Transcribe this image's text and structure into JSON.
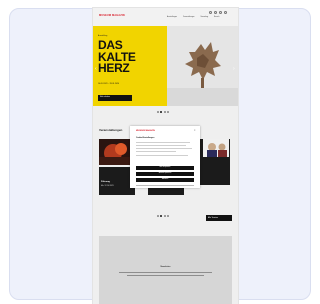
{
  "header": {
    "logo_text": "MUSEUM MAGAZIN",
    "nav": [
      "Ausstellungen",
      "Veranstaltungen",
      "Sammlung",
      "Besuch"
    ]
  },
  "hero": {
    "kicker": "Ausstellung",
    "title": "DAS KALTE HERZ",
    "dates": "14.09.2023 – 28.01.2024",
    "button_label": "Mehr erfahren",
    "accent_color": "#f1d400",
    "slider_prev": "‹",
    "slider_next": "›"
  },
  "section": {
    "title": "Veranstaltungen",
    "events": [
      {
        "title": "Führung",
        "date": "Mo. 12.10.2023"
      },
      {
        "title": "Vortrag",
        "date": "Di. 13.10.2023"
      }
    ],
    "more_label": "Alle Termine"
  },
  "cookie_modal": {
    "logo_text": "MUSEUM MAGAZIN",
    "heading": "Cookie-Einstellungen",
    "close_icon": "×",
    "buttons": [
      "Alle akzeptieren",
      "Auswahl speichern",
      "Ablehnen"
    ]
  },
  "footer": {
    "title": "Newsletter"
  },
  "colors": {
    "brand_red": "#d81e2a",
    "dark": "#111111"
  }
}
